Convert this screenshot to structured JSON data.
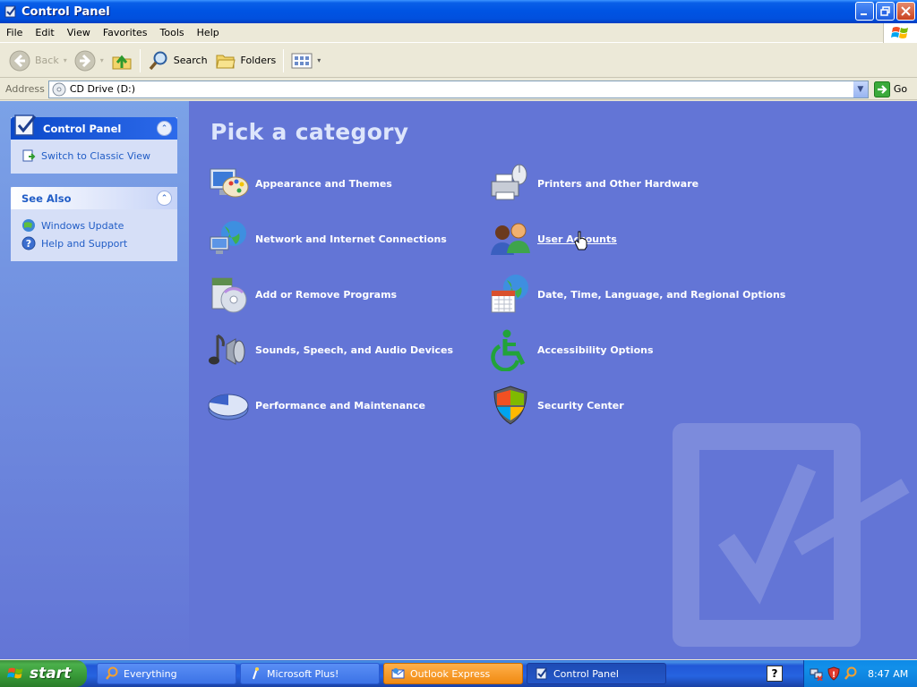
{
  "window": {
    "title": "Control Panel"
  },
  "menu": [
    "File",
    "Edit",
    "View",
    "Favorites",
    "Tools",
    "Help"
  ],
  "toolbar": {
    "back": "Back",
    "search": "Search",
    "folders": "Folders"
  },
  "address": {
    "label": "Address",
    "value": "CD Drive (D:)",
    "go": "Go"
  },
  "taskpane": {
    "control_panel": {
      "title": "Control Panel",
      "switch_view": "Switch to Classic View"
    },
    "see_also": {
      "title": "See Also",
      "links": [
        "Windows Update",
        "Help and Support"
      ]
    }
  },
  "main": {
    "heading": "Pick a category",
    "categories_left": [
      "Appearance and Themes",
      "Network and Internet Connections",
      "Add or Remove Programs",
      "Sounds, Speech, and Audio Devices",
      "Performance and Maintenance"
    ],
    "categories_right": [
      "Printers and Other Hardware",
      "User Accounts",
      "Date, Time, Language, and Regional Options",
      "Accessibility Options",
      "Security Center"
    ]
  },
  "taskbar": {
    "start": "start",
    "tasks": [
      "Everything",
      "Microsoft Plus!",
      "Outlook Express",
      "Control Panel"
    ],
    "clock": "8:47 AM"
  },
  "colors": {
    "main_bg": "#6375D6",
    "title_bar": "#0054E3",
    "task_link": "#215DC6",
    "start_green": "#379837",
    "flash_orange": "#F08A12"
  },
  "icons": [
    "control-panel-icon",
    "back-arrow-icon",
    "forward-arrow-icon",
    "up-folder-icon",
    "search-icon",
    "folders-icon",
    "views-icon",
    "cd-drive-icon",
    "go-arrow-icon",
    "windows-update-icon",
    "help-icon",
    "appearance-icon",
    "network-icon",
    "add-remove-programs-icon",
    "sounds-icon",
    "performance-icon",
    "printers-icon",
    "user-accounts-icon",
    "date-time-icon",
    "accessibility-icon",
    "security-center-icon",
    "windows-logo-icon",
    "hand-cursor-icon"
  ]
}
